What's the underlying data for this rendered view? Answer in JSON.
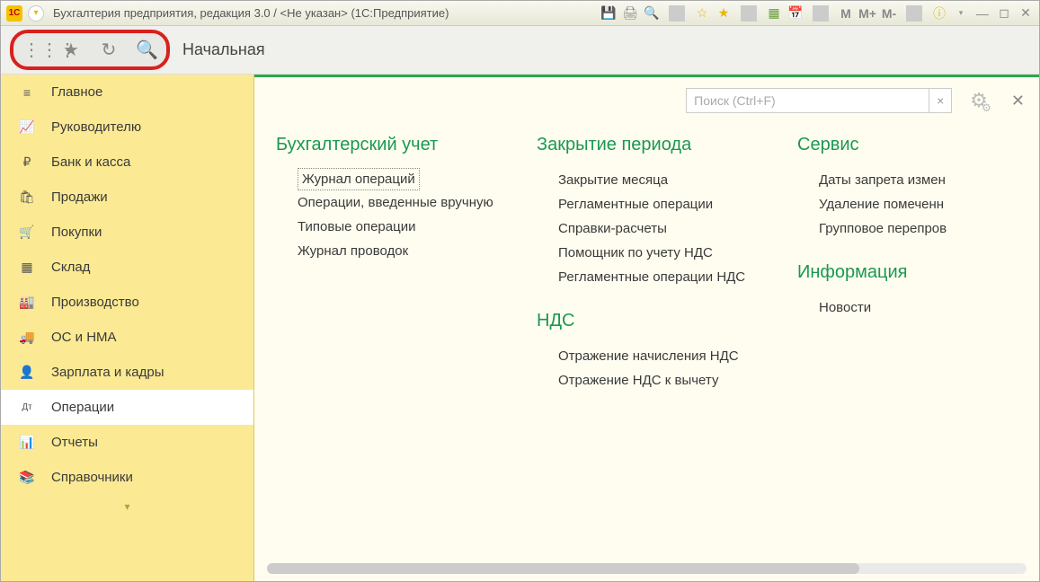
{
  "window": {
    "logo": "1C",
    "title": "Бухгалтерия предприятия, редакция 3.0 / <Не указан>  (1С:Предприятие)"
  },
  "toolbar_buttons": {
    "m1": "M",
    "m2": "M+",
    "m3": "M-"
  },
  "tab": {
    "start": "Начальная"
  },
  "search": {
    "placeholder": "Поиск (Ctrl+F)",
    "clear": "×"
  },
  "sidebar": {
    "items": [
      {
        "icon": "≡",
        "label": "Главное"
      },
      {
        "icon": "📈",
        "label": "Руководителю"
      },
      {
        "icon": "₽",
        "label": "Банк и касса"
      },
      {
        "icon": "🛍",
        "label": "Продажи"
      },
      {
        "icon": "🛒",
        "label": "Покупки"
      },
      {
        "icon": "▦",
        "label": "Склад"
      },
      {
        "icon": "🏭",
        "label": "Производство"
      },
      {
        "icon": "🚚",
        "label": "ОС и НМА"
      },
      {
        "icon": "👤",
        "label": "Зарплата и кадры"
      },
      {
        "icon": "Дт",
        "label": "Операции"
      },
      {
        "icon": "📊",
        "label": "Отчеты"
      },
      {
        "icon": "📚",
        "label": "Справочники"
      }
    ]
  },
  "panel": {
    "col1_title": "Бухгалтерский учет",
    "col1": [
      "Журнал операций",
      "Операции, введенные вручную",
      "Типовые операции",
      "Журнал проводок"
    ],
    "col2_title": "Закрытие периода",
    "col2": [
      "Закрытие месяца",
      "Регламентные операции",
      "Справки-расчеты",
      "Помощник по учету НДС",
      "Регламентные операции НДС"
    ],
    "col2b_title": "НДС",
    "col2b": [
      "Отражение начисления НДС",
      "Отражение НДС к вычету"
    ],
    "col3_title": "Сервис",
    "col3": [
      "Даты запрета измен",
      "Удаление помеченн",
      "Групповое перепров"
    ],
    "col3b_title": "Информация",
    "col3b": [
      "Новости"
    ]
  }
}
